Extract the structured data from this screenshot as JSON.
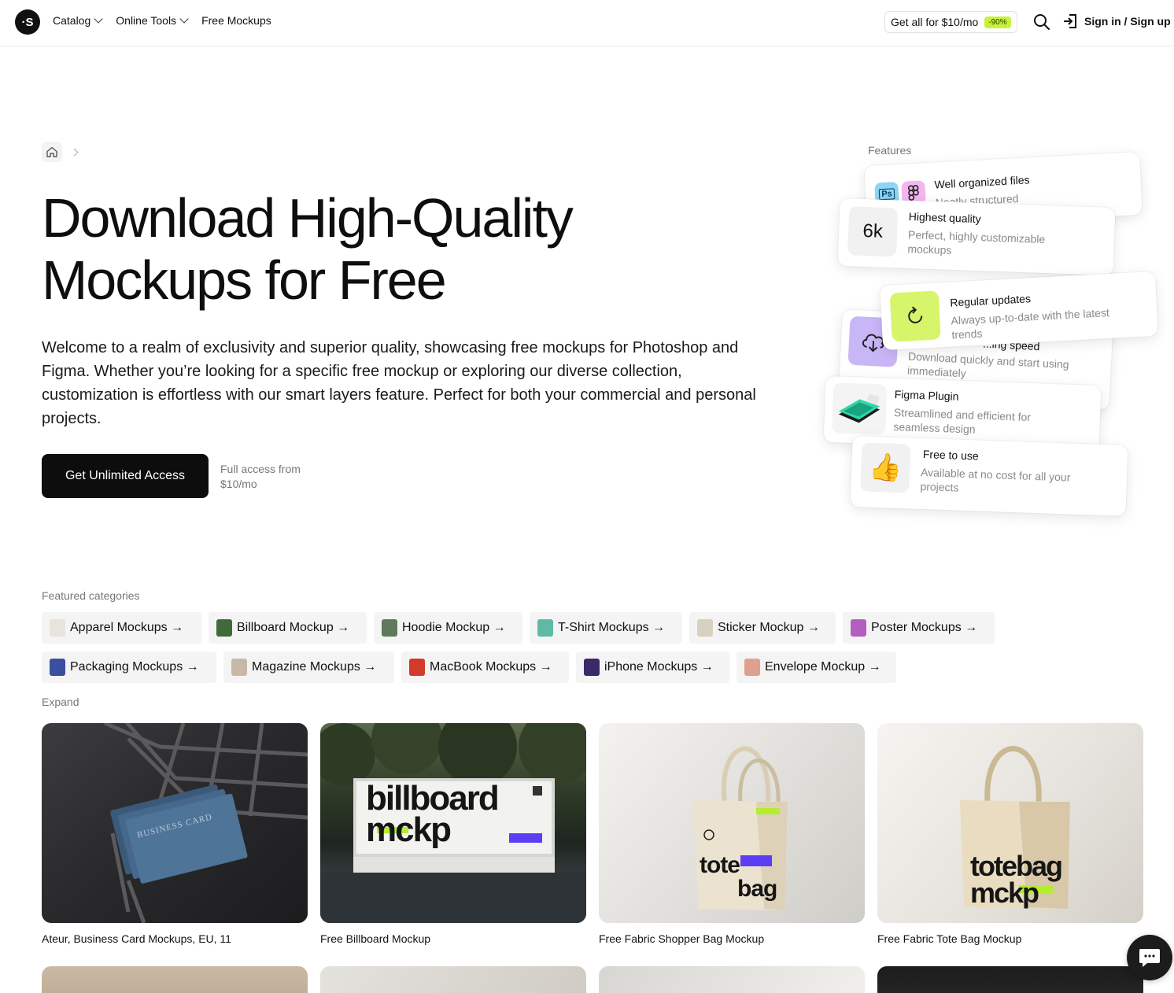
{
  "header": {
    "logo_text": "·S",
    "nav": [
      {
        "label": "Catalog",
        "has_dropdown": true
      },
      {
        "label": "Online Tools",
        "has_dropdown": true
      },
      {
        "label": "Free Mockups",
        "has_dropdown": false
      }
    ],
    "promo": {
      "label": "Get all for $10/mo",
      "badge": "-90%"
    },
    "search_icon": "search-icon",
    "signin_label": "Sign in / Sign up"
  },
  "hero": {
    "title_line1": "Download High-Quality",
    "title_line2": "Mockups for Free",
    "description": "Welcome to a realm of exclusivity and superior quality, showcasing free mockups for Photoshop and Figma. Whether you’re looking for a specific free mockup or exploring our diverse collection, customization is effortless with our smart layers feature. Perfect for both your commercial and personal projects.",
    "cta_label": "Get Unlimited Access",
    "cta_note": "Full access from $10/mo"
  },
  "features": {
    "label": "Features",
    "items": [
      {
        "title": "Well organized files",
        "subtitle": "Neatly structured"
      },
      {
        "icon_text": "6k",
        "title": "Highest quality",
        "subtitle": "Perfect, highly customizable mockups"
      },
      {
        "title": "Regular updates",
        "subtitle": "Always up-to-date with the latest trends"
      },
      {
        "title": "...ing speed",
        "subtitle": "Download quickly and start using immediately"
      },
      {
        "title": "Figma Plugin",
        "subtitle": "Streamlined and efficient for seamless design"
      },
      {
        "title": "Free to use",
        "subtitle": "Available at no cost for all your projects"
      }
    ]
  },
  "categories": {
    "label": "Featured categories",
    "items": [
      {
        "label": "Apparel Mockups →",
        "thumb_color": "#e8e4dc"
      },
      {
        "label": "Billboard Mockup →",
        "thumb_color": "#3f6b3a"
      },
      {
        "label": "Hoodie Mockup →",
        "thumb_color": "#5e7a5a"
      },
      {
        "label": "T-Shirt Mockups →",
        "thumb_color": "#5fb8a8"
      },
      {
        "label": "Sticker Mockup →",
        "thumb_color": "#d8d0c0"
      },
      {
        "label": "Poster Mockups →",
        "thumb_color": "#b25fc0"
      },
      {
        "label": "Packaging Mockups →",
        "thumb_color": "#3a4fa0"
      },
      {
        "label": "Magazine Mockups →",
        "thumb_color": "#c8b8a8"
      },
      {
        "label": "MacBook Mockups →",
        "thumb_color": "#d23a2a"
      },
      {
        "label": "iPhone Mockups →",
        "thumb_color": "#3a2a6a"
      },
      {
        "label": "Envelope Mockup →",
        "thumb_color": "#e0a090"
      }
    ],
    "expand_label": "Expand"
  },
  "cards": [
    {
      "title": "Ateur, Business Card Mockups, EU, 11",
      "img_text": "BUSINESS CARD"
    },
    {
      "title": "Free Billboard Mockup",
      "img_line1": "billboard",
      "img_line2": "mckp"
    },
    {
      "title": "Free Fabric Shopper Bag Mockup",
      "img_line1": "tote",
      "img_line2": "bag"
    },
    {
      "title": "Free Fabric Tote Bag Mockup",
      "img_line1": "totebag",
      "img_line2": "mckp"
    }
  ],
  "chat_icon": "chat-icon"
}
